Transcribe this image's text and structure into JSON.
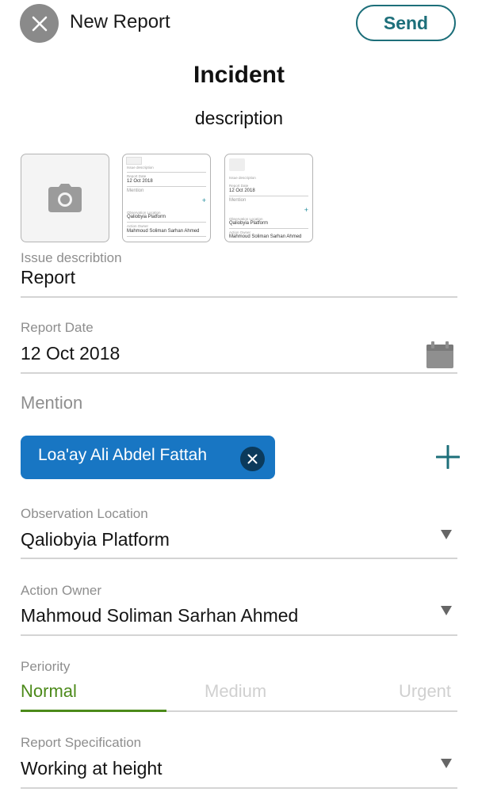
{
  "header": {
    "title": "New Report",
    "send_label": "Send"
  },
  "report": {
    "type": "Incident",
    "subtitle": "description"
  },
  "attachments": {
    "thumb1": {
      "issue_label": "Issue description",
      "date_label": "Report Date",
      "date": "12 Oct 2018",
      "mention": "Mention",
      "location_label": "Observation Location",
      "location": "Qaliobyia Platform",
      "owner_label": "Action Owner",
      "owner": "Mahmoud Soliman Sarhan Ahmed"
    },
    "thumb2": {
      "issue_label": "Issue description",
      "date_label": "Report Date",
      "date": "12 Oct 2018",
      "mention": "Mention",
      "location_label": "Observation Location",
      "location": "Qaliobyia Platform",
      "owner_label": "Action Owner",
      "owner": "Mahmoud Soliman Sarhan Ahmed"
    }
  },
  "fields": {
    "issue": {
      "label": "Issue describtion",
      "value": "Report"
    },
    "date": {
      "label": "Report Date",
      "value": "12 Oct 2018"
    },
    "mention": {
      "label": "Mention",
      "chip": "Loa'ay Ali Abdel Fattah"
    },
    "location": {
      "label": "Observation Location",
      "value": "Qaliobyia Platform"
    },
    "owner": {
      "label": "Action Owner",
      "value": "Mahmoud Soliman Sarhan Ahmed"
    },
    "priority": {
      "label": "Periority",
      "options": [
        "Normal",
        "Medium",
        "Urgent"
      ],
      "selected": "Normal"
    },
    "specification": {
      "label": "Report Specification",
      "value": "Working at height"
    }
  },
  "colors": {
    "accent_teal": "#1d6f7a",
    "chip_blue": "#1876c3",
    "priority_green": "#4c8a1a"
  }
}
